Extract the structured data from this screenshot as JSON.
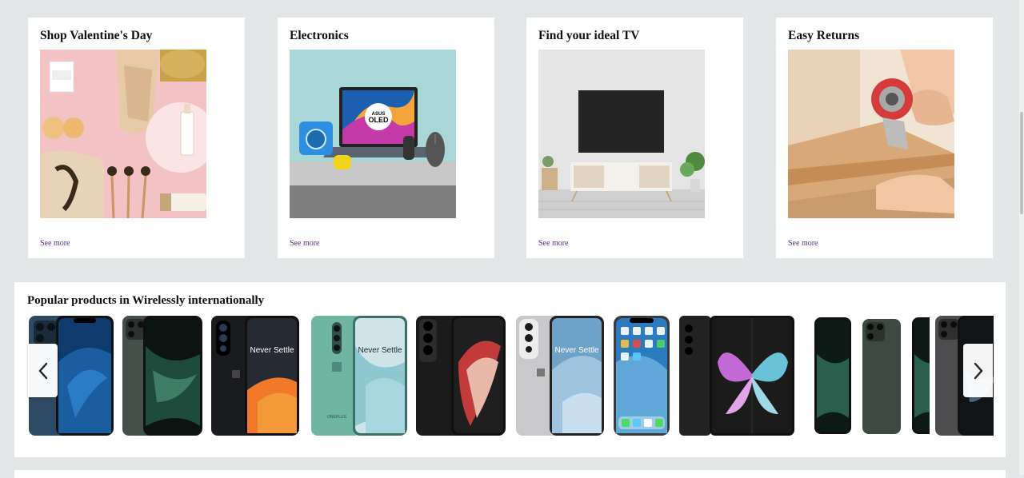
{
  "cards": [
    {
      "title": "Shop Valentine's Day",
      "link": "See more"
    },
    {
      "title": "Electronics",
      "link": "See more"
    },
    {
      "title": "Find your ideal TV",
      "link": "See more"
    },
    {
      "title": "Easy Returns",
      "link": "See more"
    }
  ],
  "electronics_image_text": {
    "brand": "ASUS",
    "panel": "OLED"
  },
  "carousel": {
    "title": "Popular products in Wirelessly internationally",
    "phone_screen_text": "Never Settle",
    "phone_back_text": "ONEPLUS",
    "prev_icon": "chevron-left-icon",
    "next_icon": "chevron-right-icon"
  },
  "colors": {
    "page_bg": "#e3e6e6",
    "link": "#5c2d91"
  }
}
